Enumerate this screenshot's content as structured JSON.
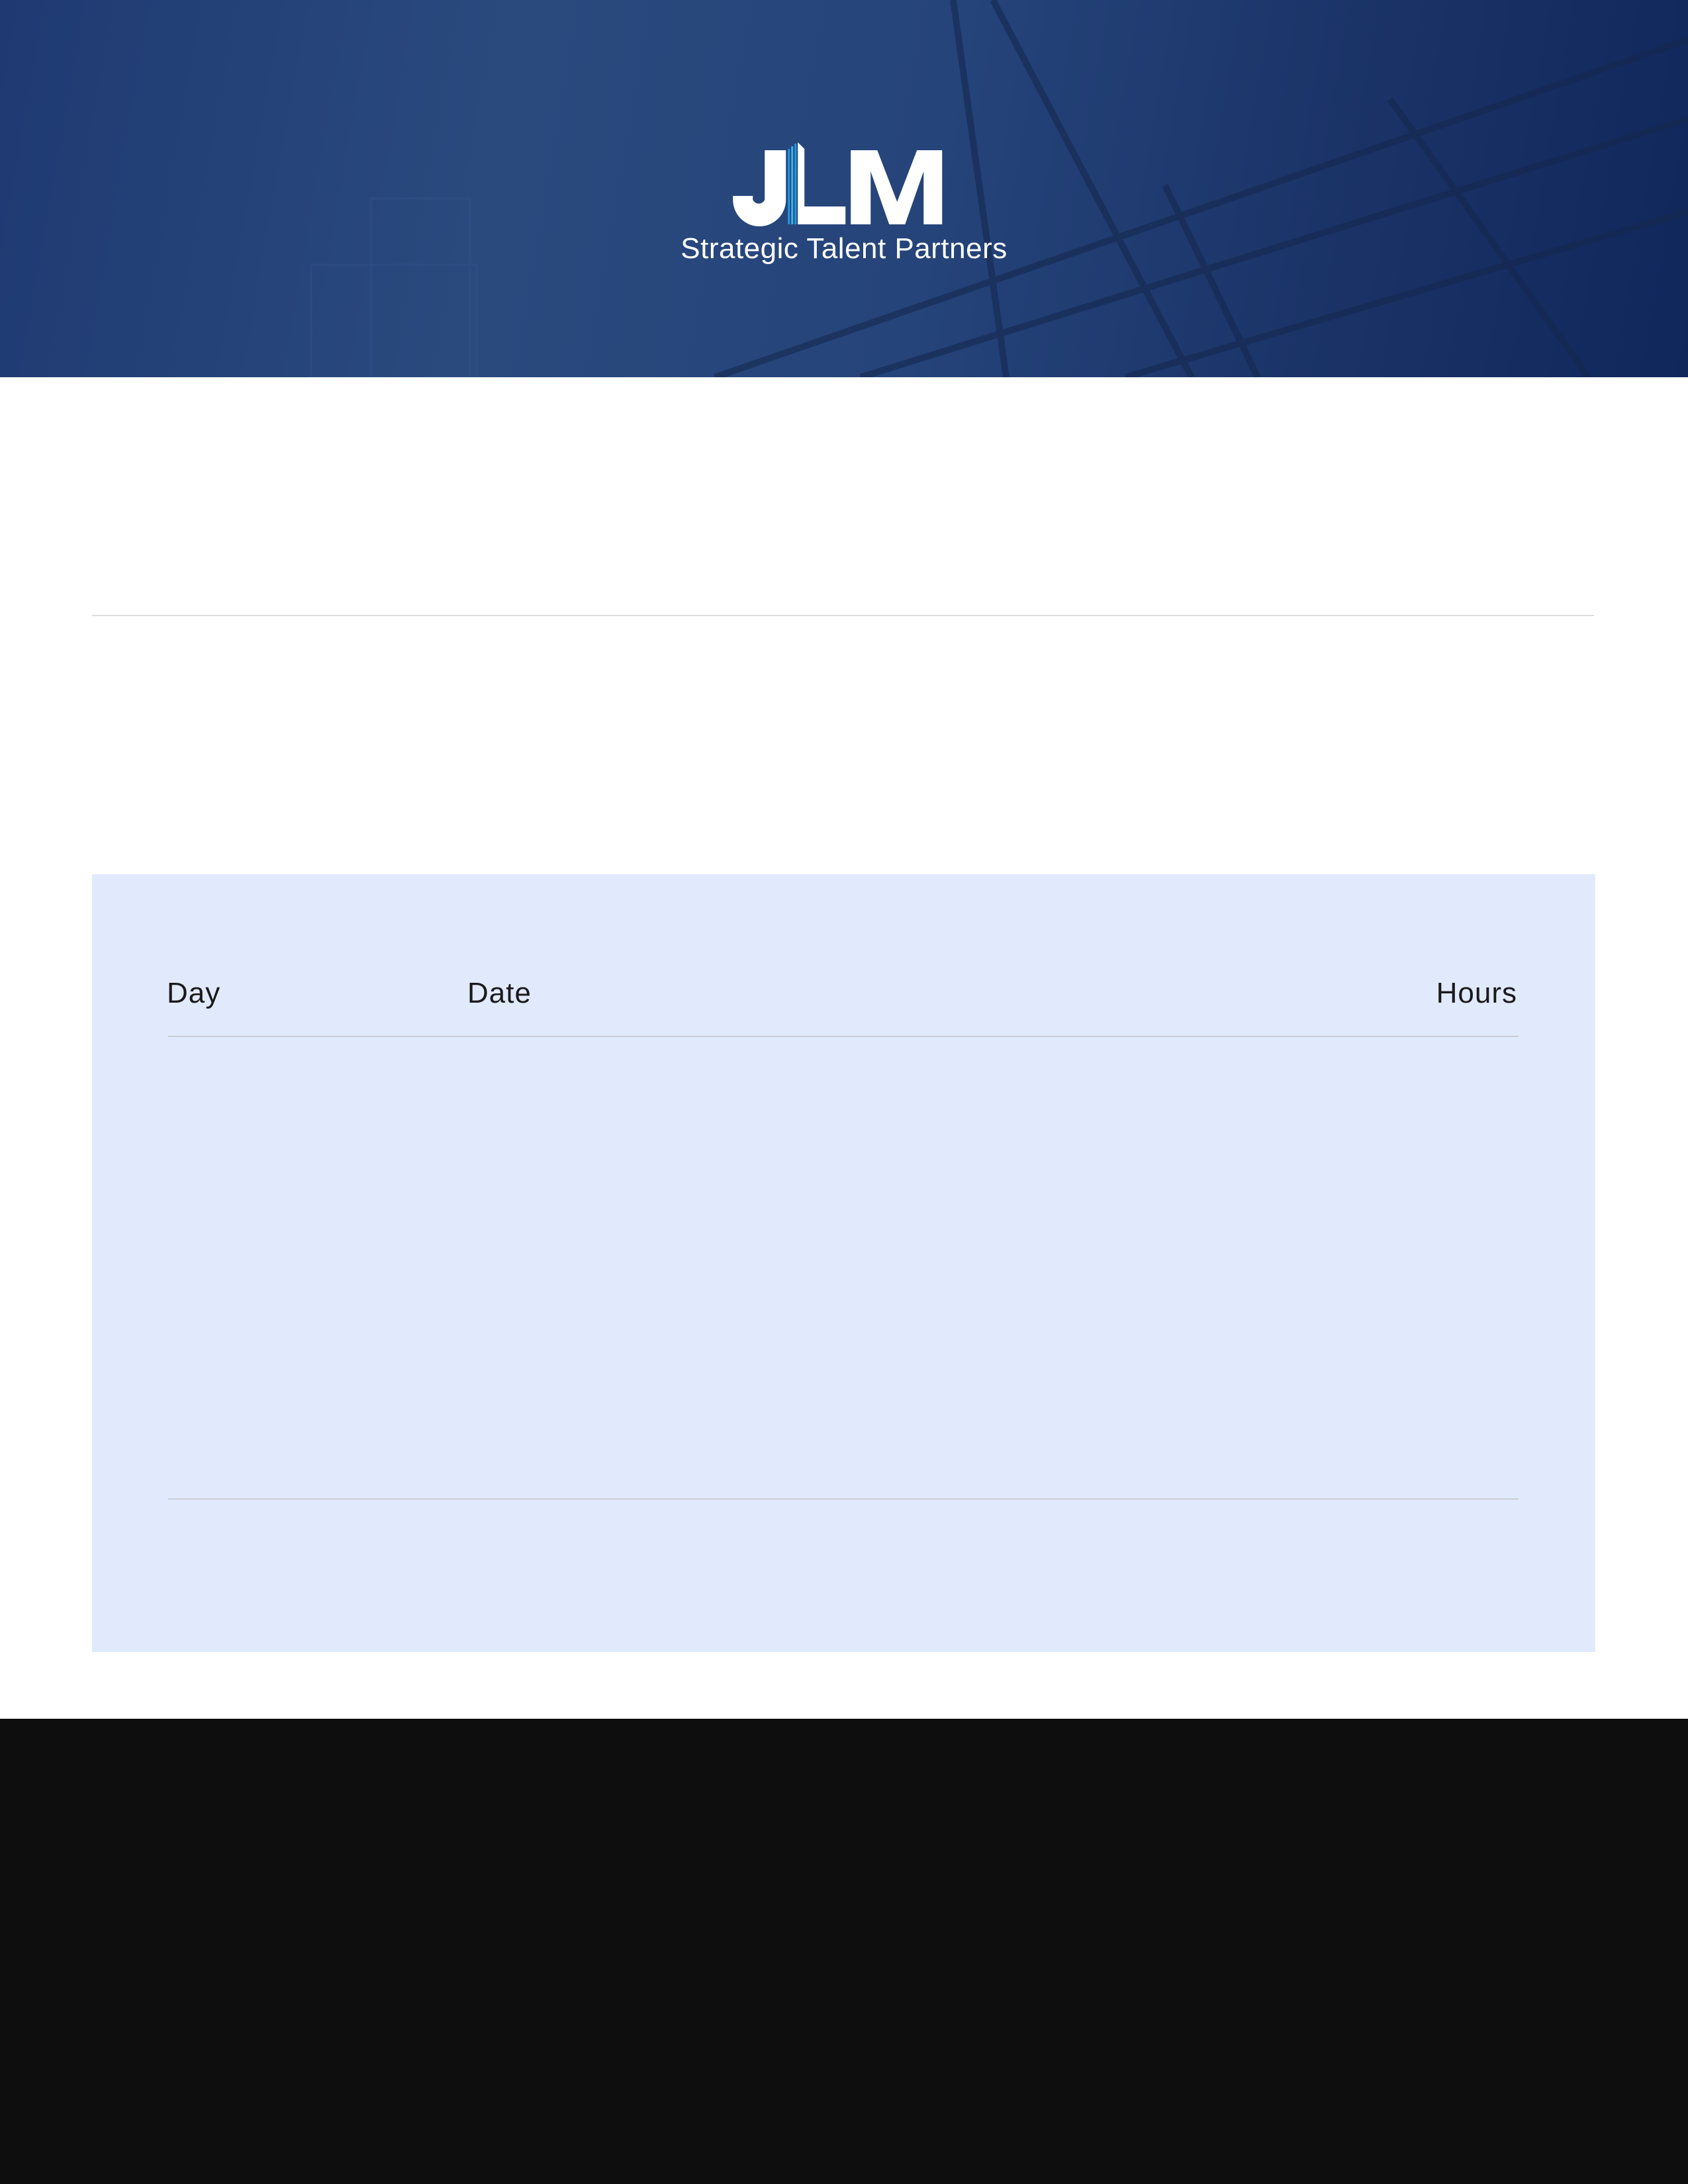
{
  "header": {
    "logo_text": "JLM",
    "tagline": "Strategic Talent Partners"
  },
  "timesheet": {
    "columns": [
      "Day",
      "Date",
      "Hours"
    ]
  },
  "colors": {
    "hero": "#24427a",
    "panel": "#e1eafd",
    "footer": "#0e0e0e",
    "accent": "#1e9be0"
  }
}
